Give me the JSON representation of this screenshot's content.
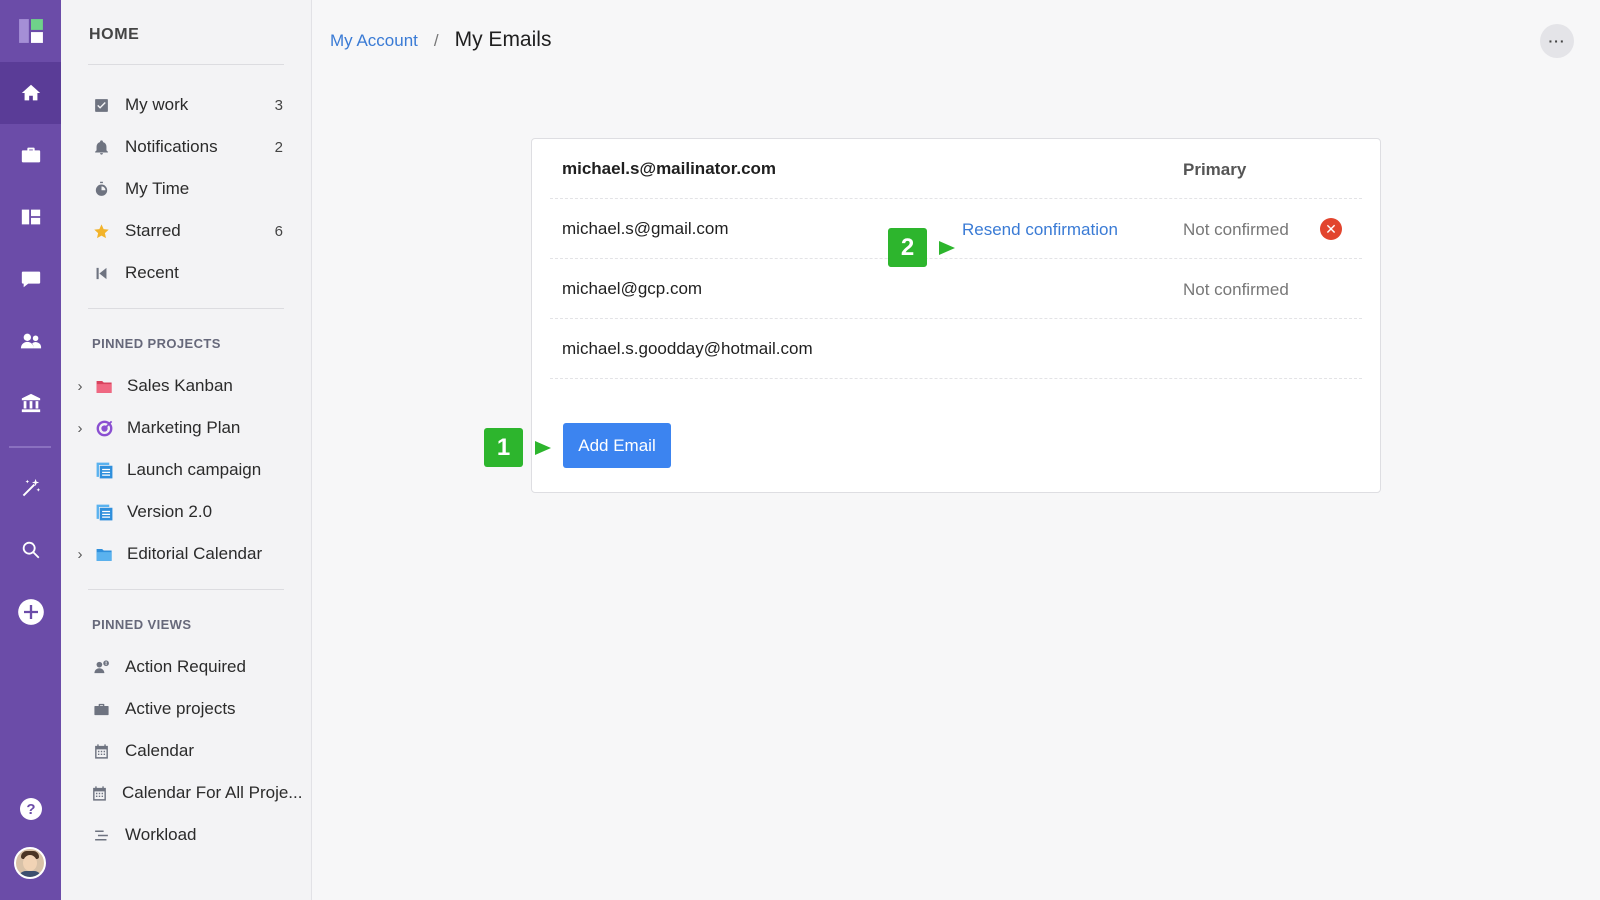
{
  "colors": {
    "rail": "#6b4ca8",
    "accent": "#3c84f0",
    "link": "#3a7bd5",
    "step_marker": "#2db52d",
    "danger": "#e2452e"
  },
  "rail": {
    "icons": [
      "logo-icon",
      "home-icon",
      "briefcase-icon",
      "dashboard-icon",
      "chat-icon",
      "people-icon",
      "bank-icon",
      "magic-wand-icon",
      "search-icon",
      "plus-circle-icon",
      "help-icon"
    ]
  },
  "sidebar": {
    "home_label": "HOME",
    "items": [
      {
        "label": "My work",
        "count": "3",
        "icon": "checkbox-icon"
      },
      {
        "label": "Notifications",
        "count": "2",
        "icon": "bell-icon"
      },
      {
        "label": "My Time",
        "count": "",
        "icon": "stopwatch-icon"
      },
      {
        "label": "Starred",
        "count": "6",
        "icon": "star-icon"
      },
      {
        "label": "Recent",
        "count": "",
        "icon": "recent-icon"
      }
    ],
    "pinned_projects_label": "PINNED PROJECTS",
    "projects": [
      {
        "label": "Sales Kanban",
        "icon": "folder-icon"
      },
      {
        "label": "Marketing Plan",
        "icon": "target-icon"
      },
      {
        "label": "Launch campaign",
        "icon": "list-doc-icon"
      },
      {
        "label": "Version 2.0",
        "icon": "list-doc-icon"
      },
      {
        "label": "Editorial Calendar",
        "icon": "folder-icon"
      }
    ],
    "pinned_views_label": "PINNED VIEWS",
    "views": [
      {
        "label": "Action Required",
        "icon": "user-alert-icon"
      },
      {
        "label": "Active projects",
        "icon": "briefcase-icon"
      },
      {
        "label": "Calendar",
        "icon": "calendar-icon"
      },
      {
        "label": "Calendar For All Proje...",
        "icon": "calendar-icon"
      },
      {
        "label": "Workload",
        "icon": "workload-icon"
      }
    ]
  },
  "header": {
    "breadcrumb_parent": "My Account",
    "breadcrumb_sep": "/",
    "title": "My Emails",
    "more_label": "···"
  },
  "emails": {
    "rows": [
      {
        "address": "michael.s@mailinator.com",
        "status": "Primary"
      },
      {
        "address": "michael.s@gmail.com",
        "status": "Not confirmed",
        "action": "Resend confirmation"
      },
      {
        "address": "michael@gcp.com",
        "status": "Not confirmed"
      },
      {
        "address": "michael.s.goodday@hotmail.com",
        "status": ""
      }
    ],
    "delete_label": "✕",
    "add_button": "Add Email"
  },
  "steps": {
    "one": "1",
    "two": "2"
  }
}
